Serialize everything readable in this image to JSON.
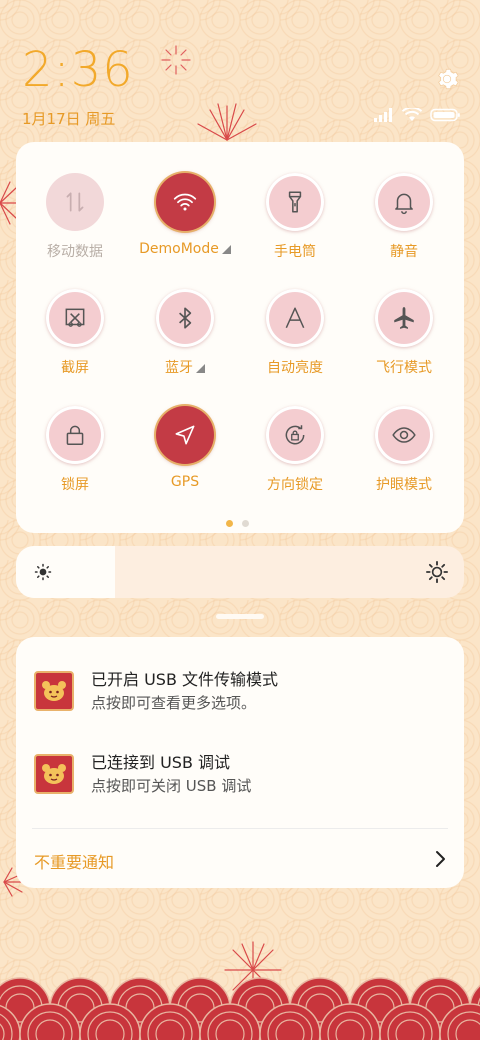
{
  "status": {
    "time": "2:36",
    "date": "1月17日 周五"
  },
  "colors": {
    "accent": "#f2a92b",
    "tile_on": "#c33b45",
    "tile_off": "#f4cdd0",
    "panel": "#fffdf9",
    "background": "#fbe5c8"
  },
  "quick_settings": {
    "tiles": [
      {
        "label": "移动数据",
        "icon": "mobile-data-icon",
        "state": "disabled"
      },
      {
        "label": "DemoMode",
        "icon": "wifi-icon",
        "state": "on",
        "expandable": true
      },
      {
        "label": "手电筒",
        "icon": "flashlight-icon",
        "state": "off"
      },
      {
        "label": "静音",
        "icon": "bell-icon",
        "state": "off"
      },
      {
        "label": "截屏",
        "icon": "screenshot-icon",
        "state": "off"
      },
      {
        "label": "蓝牙",
        "icon": "bluetooth-icon",
        "state": "off",
        "expandable": true
      },
      {
        "label": "自动亮度",
        "icon": "auto-brightness-icon",
        "state": "off"
      },
      {
        "label": "飞行模式",
        "icon": "airplane-icon",
        "state": "off"
      },
      {
        "label": "锁屏",
        "icon": "lock-icon",
        "state": "off"
      },
      {
        "label": "GPS",
        "icon": "location-arrow-icon",
        "state": "on"
      },
      {
        "label": "方向锁定",
        "icon": "rotation-lock-icon",
        "state": "off"
      },
      {
        "label": "护眼模式",
        "icon": "eye-icon",
        "state": "off"
      }
    ],
    "pages": 2,
    "current_page": 1
  },
  "brightness": {
    "level": 0.22
  },
  "notifications": [
    {
      "title": "已开启 USB 文件传输模式",
      "text": "点按即可查看更多选项。",
      "icon": "app-icon"
    },
    {
      "title": "已连接到 USB 调试",
      "text": "点按即可关闭 USB 调试",
      "icon": "app-icon"
    }
  ],
  "unimportant_label": "不重要通知"
}
